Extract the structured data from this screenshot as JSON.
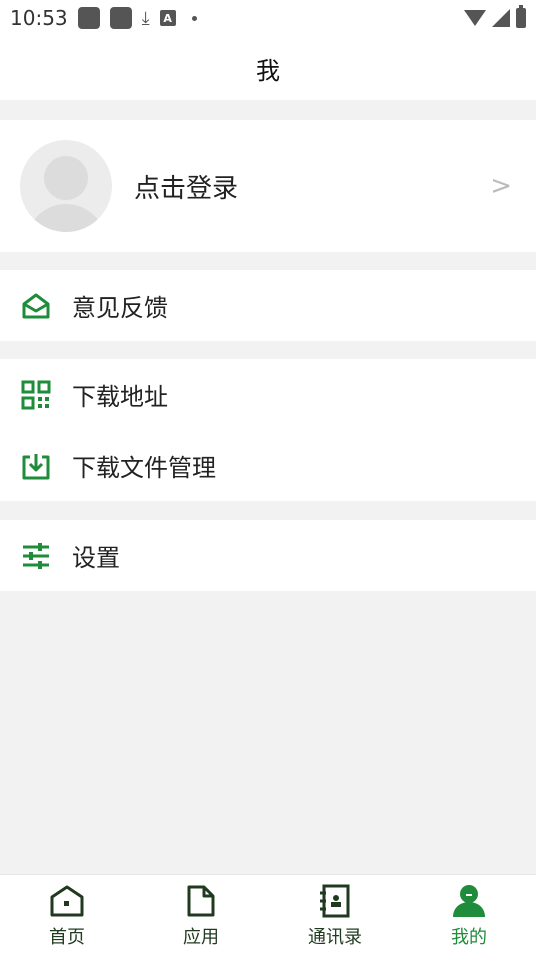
{
  "status_bar": {
    "time": "10:53"
  },
  "header": {
    "title": "我"
  },
  "profile": {
    "login_label": "点击登录"
  },
  "menu": {
    "feedback": "意见反馈",
    "download_address": "下载地址",
    "download_manager": "下载文件管理",
    "settings": "设置"
  },
  "bottom_nav": [
    {
      "label": "首页"
    },
    {
      "label": "应用"
    },
    {
      "label": "通讯录"
    },
    {
      "label": "我的"
    }
  ],
  "colors": {
    "accent": "#1e8c3a",
    "background": "#f2f2f2"
  }
}
